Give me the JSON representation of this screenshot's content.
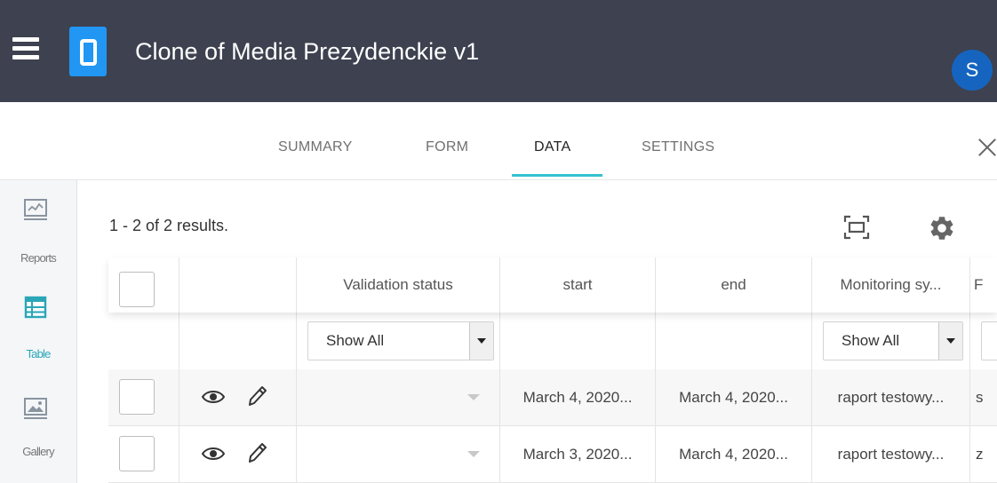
{
  "app": {
    "title": "Clone of Media Prezydenckie v1",
    "avatar_initial": "S"
  },
  "tabs": [
    {
      "label": "SUMMARY",
      "active": false
    },
    {
      "label": "FORM",
      "active": false
    },
    {
      "label": "DATA",
      "active": true
    },
    {
      "label": "SETTINGS",
      "active": false
    }
  ],
  "sidebar": {
    "items": [
      {
        "label": "Reports",
        "icon": "reports-icon",
        "active": false
      },
      {
        "label": "Table",
        "icon": "table-icon",
        "active": true
      },
      {
        "label": "Gallery",
        "icon": "gallery-icon",
        "active": false
      }
    ]
  },
  "table": {
    "results_text": "1 - 2 of 2 results.",
    "columns": [
      "Validation status",
      "start",
      "end",
      "Monitoring sy...",
      "F"
    ],
    "filters": {
      "validation_status": "Show All",
      "monitoring": "Show All"
    },
    "rows": [
      {
        "start": "March 4, 2020...",
        "end": "March 4, 2020...",
        "monitoring": "raport testowy...",
        "extra": "s"
      },
      {
        "start": "March 3, 2020...",
        "end": "March 4, 2020...",
        "monitoring": "raport testowy...",
        "extra": "z"
      }
    ]
  },
  "colors": {
    "header_bg": "#3e414f",
    "accent": "#35c1d0",
    "logo": "#2196f3",
    "avatar": "#1565c0"
  }
}
